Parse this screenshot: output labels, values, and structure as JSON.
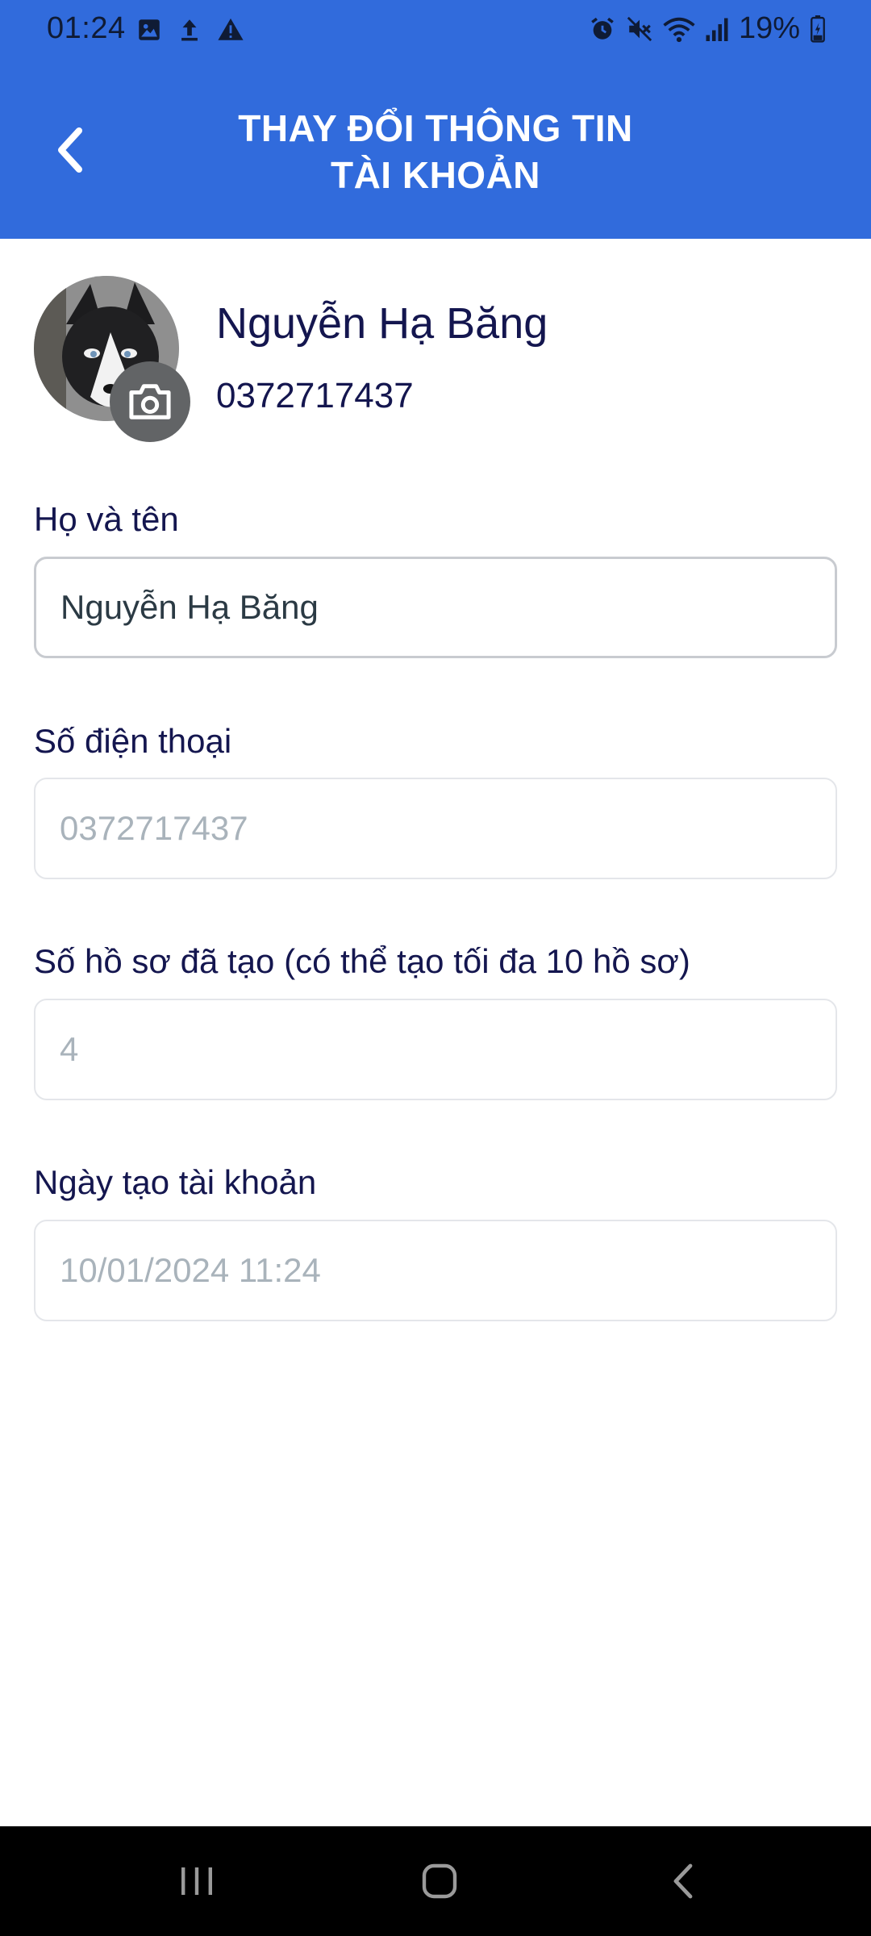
{
  "status_bar": {
    "time": "01:24",
    "battery": "19%"
  },
  "header": {
    "title_line1": "THAY ĐỔI THÔNG TIN",
    "title_line2": "TÀI KHOẢN"
  },
  "profile": {
    "name": "Nguyễn Hạ Băng",
    "phone": "0372717437"
  },
  "fields": {
    "full_name": {
      "label": "Họ và tên",
      "value": "Nguyễn Hạ Băng"
    },
    "phone": {
      "label": "Số điện thoại",
      "value": "0372717437"
    },
    "records": {
      "label": "Số hồ sơ đã tạo (có thể tạo tối đa 10 hồ sơ)",
      "value": "4"
    },
    "created": {
      "label": "Ngày tạo tài khoản",
      "value": "10/01/2024 11:24"
    }
  },
  "colors": {
    "header_bg": "#316bdc",
    "text_primary": "#14164f",
    "readonly_text": "#a9b3bb"
  },
  "icons": [
    "gallery-icon",
    "upload-icon",
    "warning-icon",
    "alarm-icon",
    "mute-icon",
    "wifi-icon",
    "signal-icon",
    "battery-icon",
    "back-arrow-icon",
    "camera-icon",
    "recent-apps-icon",
    "home-icon",
    "nav-back-icon"
  ]
}
